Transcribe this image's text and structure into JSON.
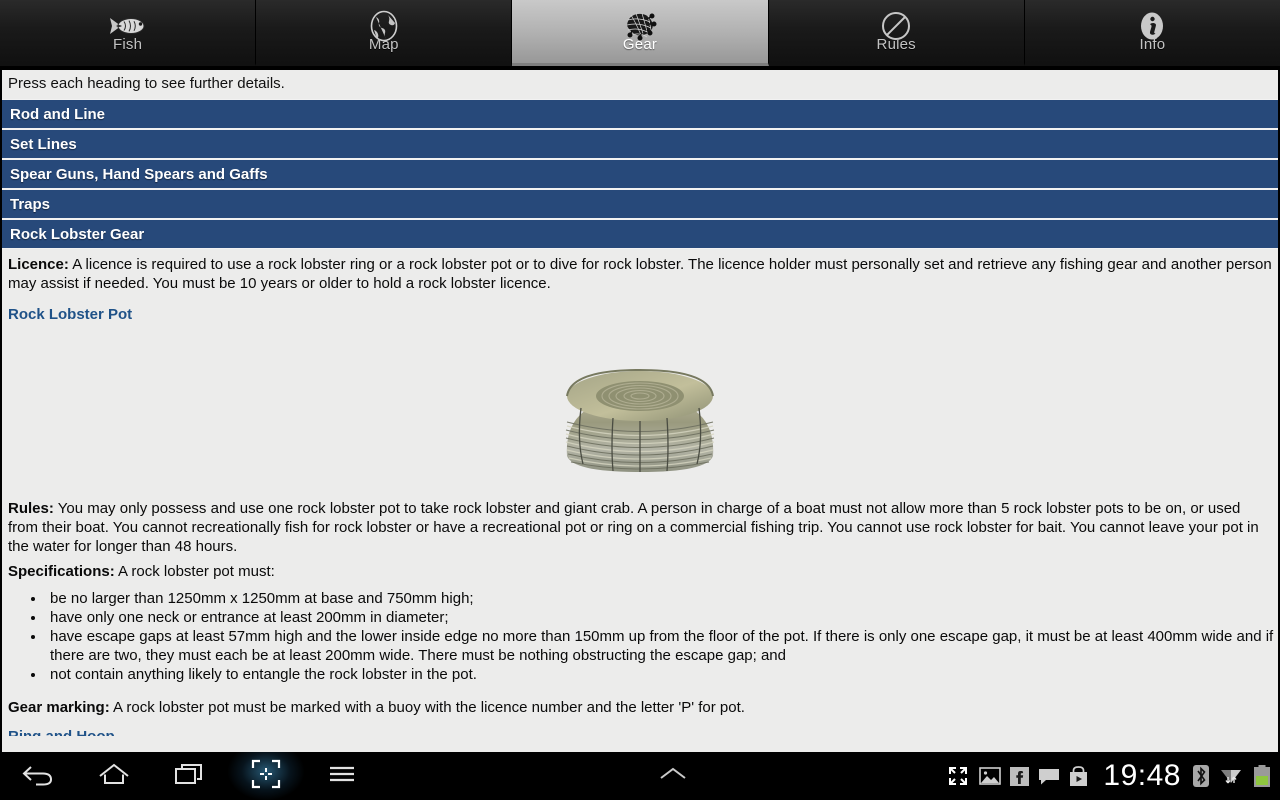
{
  "tabs": [
    {
      "label": "Fish",
      "icon": "fish-icon",
      "active": false
    },
    {
      "label": "Map",
      "icon": "globe-icon",
      "active": false
    },
    {
      "label": "Gear",
      "icon": "net-icon",
      "active": true
    },
    {
      "label": "Rules",
      "icon": "prohibition-icon",
      "active": false
    },
    {
      "label": "Info",
      "icon": "info-icon",
      "active": false
    }
  ],
  "content": {
    "intro": "Press each heading to see further details.",
    "headings": [
      "Rod and Line",
      "Set Lines",
      "Spear Guns, Hand Spears and Gaffs",
      "Traps",
      "Rock Lobster Gear"
    ],
    "licence_label": "Licence:",
    "licence_text": " A licence is required to use a rock lobster ring or a rock lobster pot or to dive for rock lobster. The licence holder must personally set and retrieve any fishing gear and another person may assist if needed. You must be 10 years or older to hold a rock lobster licence.",
    "subsection_link": "Rock Lobster Pot",
    "image_alt": "rock-lobster-pot-photo",
    "rules_label": "Rules:",
    "rules_text": " You may only possess and use one rock lobster pot to take rock lobster and giant crab. A person in charge of a boat must not allow more than 5 rock lobster pots to be on, or used from their boat. You cannot recreationally fish for rock lobster or have a recreational pot or ring on a commercial fishing trip. You cannot use rock lobster for bait. You cannot leave your pot in the water for longer than 48 hours.",
    "specs_label": "Specifications:",
    "specs_text": " A rock lobster pot must:",
    "specs_items": [
      "be no larger than 1250mm x 1250mm at base and 750mm high;",
      "have only one neck or entrance at least 200mm in diameter;",
      "have escape gaps at least 57mm high and the lower inside edge no more than 150mm up from the floor of the pot. If there is only one escape gap, it must be at least 400mm wide and if there are two, they must each be at least 200mm wide. There must be nothing obstructing the escape gap; and",
      "not contain anything likely to entangle the rock lobster in the pot."
    ],
    "gear_marking_label": "Gear marking:",
    "gear_marking_text": " A rock lobster pot must be marked with a buoy with the licence number and the letter 'P' for pot.",
    "next_link_cut": "Ring and Hoop"
  },
  "navbar": {
    "back": "back-icon",
    "home": "home-icon",
    "recents": "recents-icon",
    "screenshot": "screenshot-icon",
    "menu": "menu-icon",
    "collapse": "chevron-up-icon",
    "status": {
      "expand": "expand-icon",
      "gallery": "image-icon",
      "facebook": "facebook-icon",
      "message": "message-icon",
      "playstore": "play-store-icon",
      "time": "19:48",
      "bluetooth": "bluetooth-icon",
      "wifi": "wifi-icon",
      "battery": "battery-icon"
    }
  },
  "colors": {
    "heading_blue": "#27497a",
    "link_blue": "#1f5288",
    "content_bg": "#ececeb",
    "tab_active": "#b2b2b2",
    "battery_green": "#8ec63f"
  }
}
